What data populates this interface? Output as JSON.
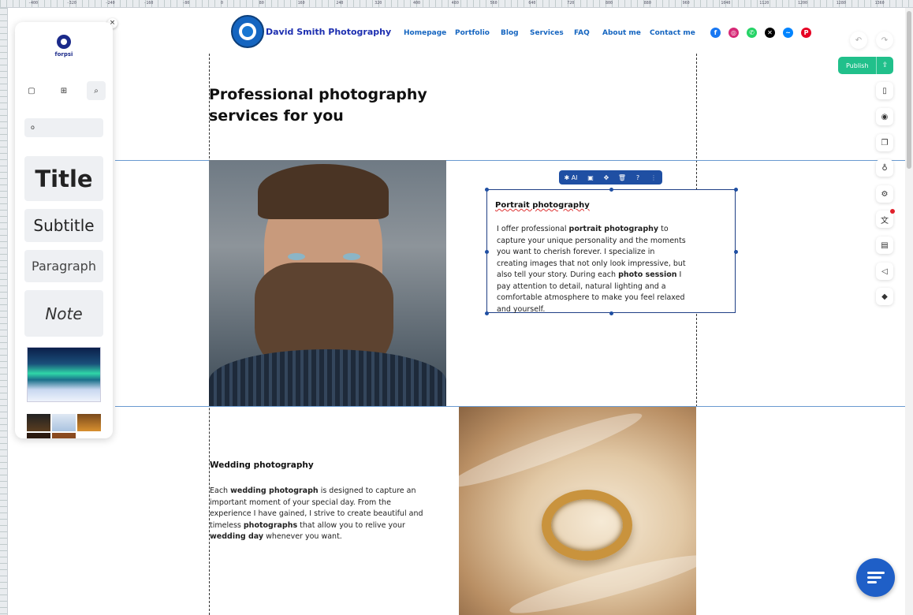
{
  "ruler": {
    "labels": [
      "-400",
      "-320",
      "-240",
      "-160",
      "-80",
      "0",
      "80",
      "160",
      "240",
      "320",
      "400",
      "480",
      "560",
      "640",
      "720",
      "800",
      "880",
      "960",
      "1040",
      "1120",
      "1200",
      "1280",
      "1360",
      "1440"
    ]
  },
  "header": {
    "brand": "David Smith Photography",
    "nav": [
      "Homepage",
      "Portfolio",
      "Blog",
      "Services",
      "FAQ",
      "About me",
      "Contact me"
    ],
    "social": [
      {
        "icon": "facebook-icon",
        "color": "#1877f2",
        "glyph": "f"
      },
      {
        "icon": "instagram-icon",
        "color": "#d62976",
        "glyph": "◎"
      },
      {
        "icon": "whatsapp-icon",
        "color": "#25d366",
        "glyph": "✆"
      },
      {
        "icon": "x-icon",
        "color": "#000000",
        "glyph": "✕"
      },
      {
        "icon": "messenger-icon",
        "color": "#0084ff",
        "glyph": "~"
      },
      {
        "icon": "pinterest-icon",
        "color": "#e60023",
        "glyph": "P"
      }
    ]
  },
  "panel": {
    "brand": "forpsi",
    "close": "×",
    "search_value": "o",
    "tiles": {
      "title": "Title",
      "subtitle": "Subtitle",
      "paragraph": "Paragraph",
      "note": "Note"
    }
  },
  "tools": {
    "publish": "Publish"
  },
  "content": {
    "heading": "Professional photography services for you",
    "toolbar": {
      "ai": "AI"
    },
    "portrait": {
      "title": "Portrait photography",
      "body_parts": [
        {
          "t": "I offer professional ",
          "b": false
        },
        {
          "t": "portrait photography",
          "b": true
        },
        {
          "t": " to capture your unique personality and the moments you want to cherish forever. I specialize in creating images that not only look impressive, but also tell your story. During each ",
          "b": false
        },
        {
          "t": "photo session",
          "b": true
        },
        {
          "t": " I pay attention to detail, natural lighting and a comfortable atmosphere to make you feel relaxed and yourself.",
          "b": false
        }
      ]
    },
    "wedding": {
      "title": "Wedding photography",
      "body_parts": [
        {
          "t": "Each ",
          "b": false
        },
        {
          "t": "wedding photograph",
          "b": true
        },
        {
          "t": " is designed to capture an important moment of your special day. From the experience I have gained, I strive to create beautiful and timeless ",
          "b": false
        },
        {
          "t": "photographs",
          "b": true
        },
        {
          "t": " that allow you to relive your ",
          "b": false
        },
        {
          "t": "wedding day",
          "b": true
        },
        {
          "t": " whenever you want.",
          "b": false
        }
      ]
    }
  }
}
